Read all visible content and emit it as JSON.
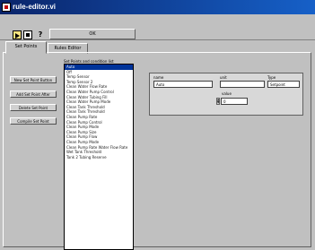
{
  "window": {
    "title": "rule-editor.vi"
  },
  "toolbar": {
    "run_icon": "run-arrow-icon",
    "stop_icon": "stop-icon",
    "help_icon": "help-icon",
    "help_glyph": "?",
    "top_button_label": "OK"
  },
  "tabs": [
    {
      "label": "Set Points"
    },
    {
      "label": "Rules Editor"
    }
  ],
  "buttons": {
    "new_set_point_button": "New Set Point Button",
    "add_set_point_after": "Add Set Point After",
    "delete_set_point": "Delete Set Point",
    "compile_set_point": "Compile Set Point"
  },
  "list": {
    "caption": "Set Points and condition list",
    "items": [
      "Auto",
      "Off",
      "Temp Sensor",
      "Temp Sensor 2",
      "Clean Water Flow Rate",
      "Clean Water Pump Control",
      "Clean Water Tubing Fill",
      "Clean Water Pump Mode",
      "Clean Tank Threshold",
      "Clean Tank Threshold",
      "Clean Pump Rate",
      "Clean Pump Control",
      "Clean Pump Mode",
      "Clean Pump Size",
      "Clean Pump Flow",
      "Clean Pump Mode",
      "Clean Pump Rate Water Flow Rate",
      "Wet Tank Threshold",
      "Tank 2 Tubing Reserve"
    ],
    "selected_index": 0
  },
  "setpoint": {
    "name_label": "name",
    "name_value": "Auto",
    "unit_label": "unit",
    "unit_value": "",
    "type_label": "Type",
    "type_value": "Setpoint",
    "value_label": "value",
    "value_value": "0"
  },
  "colors": {
    "title_bar": "#0a246a",
    "selection": "#003399",
    "background": "#c0c0c0"
  }
}
